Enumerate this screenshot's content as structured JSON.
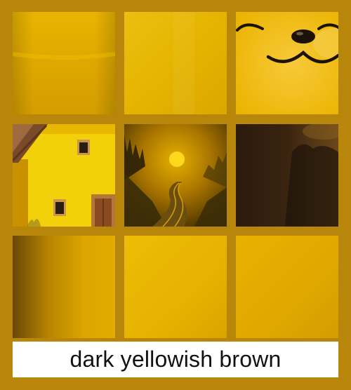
{
  "caption": {
    "label": "dark yellowish brown"
  },
  "colors": {
    "frame": "#b8860b",
    "swatch_main": "#e6b200",
    "caption_bg": "#ffffff",
    "caption_text": "#111111"
  },
  "tiles": [
    {
      "subject": "flat-gold-gradient"
    },
    {
      "subject": "flat-yellow-texture"
    },
    {
      "subject": "smiling-cartoon-face"
    },
    {
      "subject": "yellow-house"
    },
    {
      "subject": "sunset-winding-road"
    },
    {
      "subject": "dark-forest-silhouette"
    },
    {
      "subject": "dark-to-gold-gradient"
    },
    {
      "subject": "flat-yellow-gradient"
    },
    {
      "subject": "flat-amber-gradient"
    }
  ]
}
